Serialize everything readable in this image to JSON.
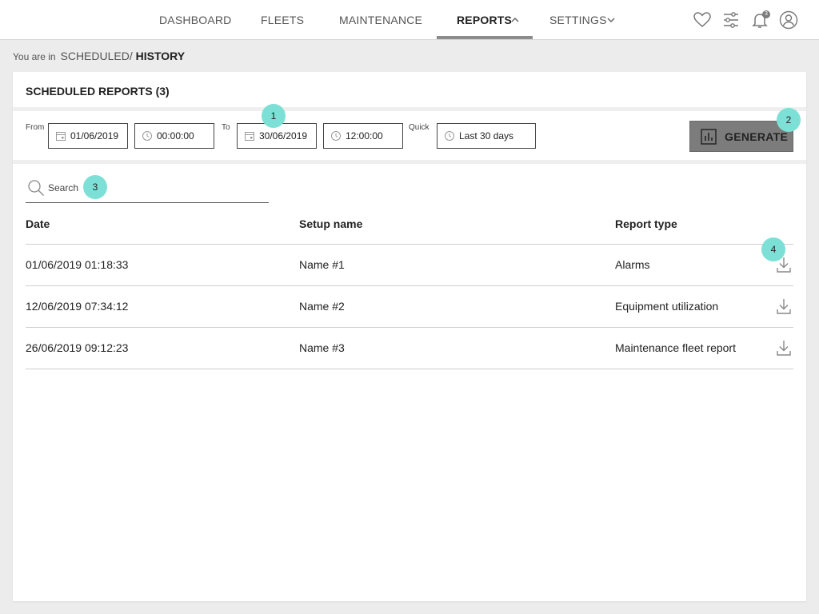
{
  "nav": {
    "items": [
      {
        "label": "DASHBOARD"
      },
      {
        "label": "FLEETS"
      },
      {
        "label": "MAINTENANCE"
      },
      {
        "label": "REPORTS",
        "active": true
      },
      {
        "label": "SETTINGS"
      }
    ],
    "notification_count": "3",
    "icons": [
      "heart-icon",
      "sliders-icon",
      "bell-icon",
      "user-icon"
    ]
  },
  "breadcrumb": {
    "prefix": "You are in",
    "path": "SCHEDULED/",
    "current": "HISTORY"
  },
  "card": {
    "title": "SCHEDULED REPORTS (3)"
  },
  "filters": {
    "from_label": "From",
    "from_date": "01/06/2019",
    "from_time": "00:00:00",
    "to_label": "To",
    "to_date": "30/06/2019",
    "to_time": "12:00:00",
    "quick_label": "Quick",
    "quick_value": "Last 30 days",
    "generate_label": "GENERATE"
  },
  "search": {
    "placeholder": "Search"
  },
  "table": {
    "columns": [
      "Date",
      "Setup name",
      "Report type"
    ],
    "rows": [
      {
        "date": "01/06/2019 01:18:33",
        "name": "Name #1",
        "type": "Alarms"
      },
      {
        "date": "12/06/2019 07:34:12",
        "name": "Name #2",
        "type": "Equipment utilization"
      },
      {
        "date": "26/06/2019 09:12:23",
        "name": "Name #3",
        "type": "Maintenance fleet report"
      }
    ]
  },
  "annotations": [
    "1",
    "2",
    "3",
    "4"
  ],
  "colors": {
    "accent_marker": "#7de0d6",
    "generate_button": "#7c7c7c",
    "active_underline": "#8c8c8c"
  }
}
